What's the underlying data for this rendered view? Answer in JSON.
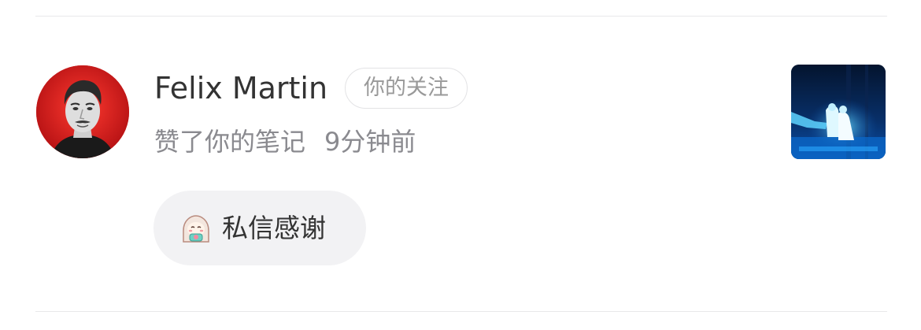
{
  "notification": {
    "user_name": "Felix Martin",
    "follow_badge": "你的关注",
    "action_text": "赞了你的笔记",
    "time_ago": "9分钟前",
    "thank_button_label": "私信感谢",
    "icons": {
      "thank_emoji": "grateful-emoji-icon"
    }
  },
  "colors": {
    "avatar_ring": "#d71f1f",
    "name_text": "#333333",
    "meta_text": "#8a8a8f",
    "badge_text": "#999999",
    "button_bg": "#f2f2f4",
    "divider": "#e8e8ea"
  }
}
